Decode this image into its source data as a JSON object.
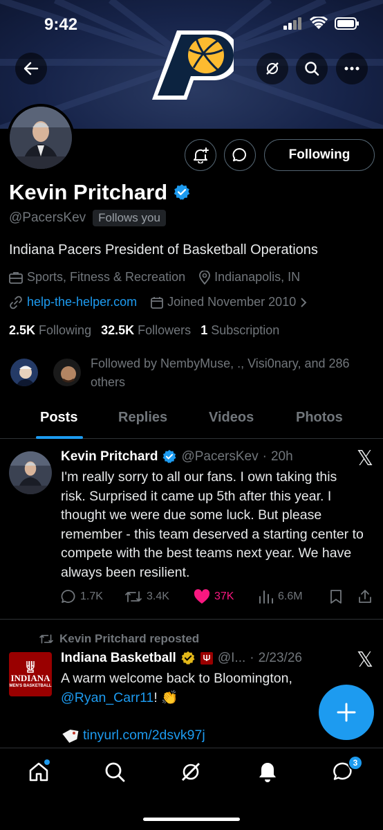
{
  "status": {
    "time": "9:42"
  },
  "profile": {
    "name": "Kevin Pritchard",
    "handle": "@PacersKev",
    "follows_you": "Follows you",
    "bio": "Indiana Pacers President of Basketball Operations",
    "category": "Sports, Fitness & Recreation",
    "location": "Indianapolis, IN",
    "website": "help-the-helper.com",
    "joined": "Joined November 2010",
    "following_button": "Following",
    "stats": {
      "following_count": "2.5K",
      "following_label": "Following",
      "followers_count": "32.5K",
      "followers_label": "Followers",
      "subscription_count": "1",
      "subscription_label": "Subscription"
    },
    "followed_by": "Followed by NembyMuse, ., Visi0nary, and 286 others"
  },
  "tabs": [
    "Posts",
    "Replies",
    "Videos",
    "Photos"
  ],
  "posts": [
    {
      "author": "Kevin Pritchard",
      "handle": "@PacersKev",
      "time": "20h",
      "text": "I'm really sorry to all our fans. I own taking this risk. Surprised it came up 5th after this year.  I thought we were due some luck. But please remember - this team deserved a starting center to compete with the best teams next year. We have always been resilient.",
      "replies": "1.7K",
      "reposts": "3.4K",
      "likes": "37K",
      "views": "6.6M"
    },
    {
      "repost_label": "Kevin Pritchard reposted",
      "author": "Indiana Basketball",
      "handle": "@I...",
      "time": "2/23/26",
      "text_line1": "A warm welcome back to Bloomington,",
      "mention": "@Ryan_Carr11",
      "text_after_mention": "! 👏",
      "link": "tinyurl.com/2dsvk97j",
      "logo_title": "INDIANA",
      "logo_sub": "MEN'S BASKETBALL"
    }
  ],
  "nav": {
    "messages_badge": "3"
  },
  "colors": {
    "accent": "#1d9bf0",
    "like": "#f91880",
    "verified_gold": "#e2b719",
    "iu_crimson": "#990000"
  }
}
